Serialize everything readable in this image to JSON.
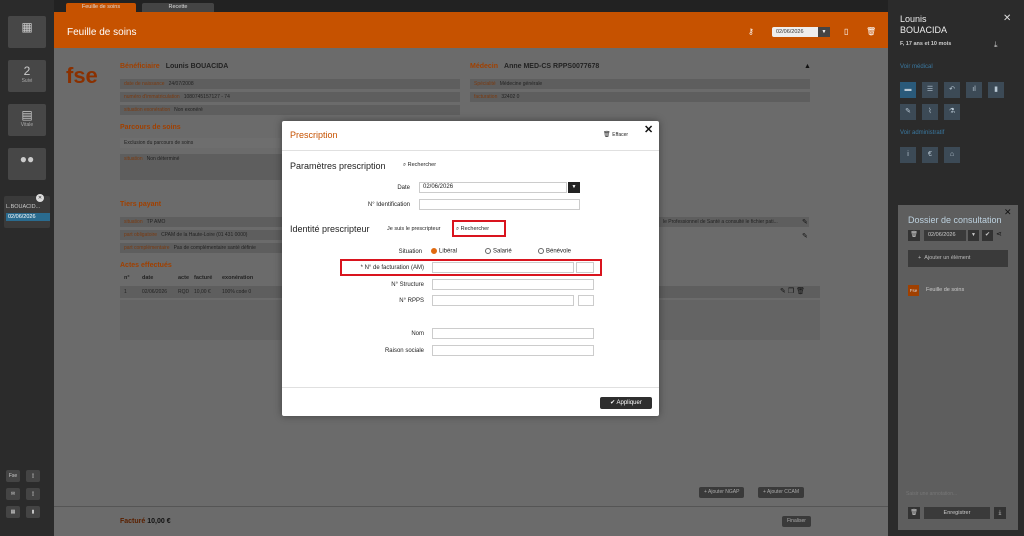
{
  "tabs": [
    {
      "label": "Feuille de soins"
    },
    {
      "label": "Recette"
    }
  ],
  "header": {
    "title": "Feuille de soins",
    "date": "02/06/2026"
  },
  "leftbar": {
    "count": "2",
    "count_label": "Suivi",
    "vitale_label": "Vitale",
    "patient_short": "L.BOUACID...",
    "patient_date": "02/06/2026",
    "bottom_fse": "Fse"
  },
  "beneficiary": {
    "label": "Bénéficiaire",
    "name": "Lounis BOUACIDA",
    "rows": [
      {
        "k": "date de naissance",
        "v": "24/07/2008"
      },
      {
        "k": "numéro d'immatriculation",
        "v": "1080745157127 - 74"
      },
      {
        "k": "situation exonération",
        "v": "Non exonéré"
      }
    ]
  },
  "doctor": {
    "label": "Médecin",
    "name": "Anne MED-CS RPPS0077678",
    "rows": [
      {
        "k": "Spécialité",
        "v": "Médecine générale"
      },
      {
        "k": "facturation",
        "v": "32402 0"
      }
    ]
  },
  "parcours": {
    "label": "Parcours de soins",
    "row1": "Exclusion du parcours de soins",
    "row2_k": "situation",
    "row2_v": "Non déterminé"
  },
  "tiers": {
    "label": "Tiers payant",
    "rows": [
      {
        "k": "situation",
        "v": "TP AMO"
      },
      {
        "k": "part obligatoire",
        "v": "CPAM de la Haute-Loire  (01 431 0000)"
      },
      {
        "k": "part complémentaire",
        "v": "Pas de complémentaire santé définie"
      }
    ],
    "right_note": "le Professionnel de Santé a consulté le fichier pati..."
  },
  "actes": {
    "label": "Actes effectués",
    "headers": [
      "n°",
      "date",
      "acte",
      "facturé",
      "exonération"
    ],
    "row": [
      "1",
      "02/06/2026",
      "RQD",
      "10,00 €",
      "100% code 0"
    ]
  },
  "footer": {
    "facture_label": "Facturé",
    "facture_value": "10,00 €",
    "add_ngap": "Ajouter NGAP",
    "add_ccam": "Ajouter CCAM",
    "finalize": "Finaliser"
  },
  "rightpanel": {
    "first_name": "Lounis",
    "last_name": "BOUACIDA",
    "age": "F, 17 ans et 10 mois",
    "section1": "Voir médical",
    "section2": "Voir administratif",
    "dossier_title": "Dossier de consultation",
    "dossier_date": "02/06/2026",
    "add_element": "Ajouter un élément",
    "item_badge": "Fse",
    "item_label": "Feuille de soins",
    "note_placeholder": "Saisir une annotation...",
    "save": "Enregistrer"
  },
  "modal": {
    "title": "Prescription",
    "clear": "Effacer",
    "section1": "Paramètres prescription",
    "search": "Rechercher",
    "date_label": "Date",
    "date_value": "02/06/2026",
    "ident_label": "N° Identification",
    "section2": "Identité prescripteur",
    "self_label": "Je suis le prescripteur",
    "search2": "Rechercher",
    "situation_label": "Situation",
    "situations": [
      "Libéral",
      "Salarié",
      "Bénévole"
    ],
    "facturation_label": "* N° de facturation (AM)",
    "structure_label": "N° Structure",
    "rpps_label": "N° RPPS",
    "nom_label": "Nom",
    "raison_label": "Raison sociale",
    "apply": "Appliquer"
  }
}
